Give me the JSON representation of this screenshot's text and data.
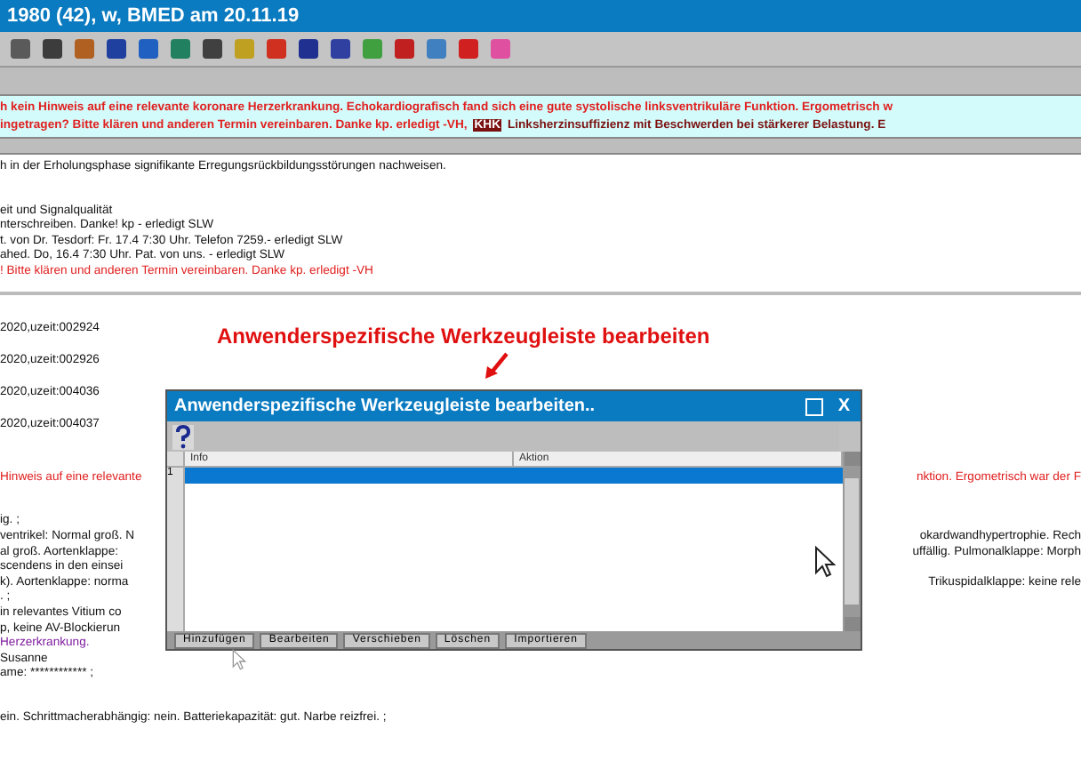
{
  "window": {
    "title": "1980 (42), w, BMED am 20.11.19"
  },
  "notice": {
    "lines": [
      {
        "parts": [
          {
            "text": "h kein Hinweis auf eine relevante koronare Herzerkrankung. Echokardiografisch fand sich eine gute systolische linksventrikuläre Funktion. Ergometrisch w",
            "kind": "alert"
          }
        ]
      },
      {
        "parts": [
          {
            "text": "ingetragen? Bitte klären und anderen Termin vereinbaren. Danke kp.  erledigt -VH,",
            "kind": "alert"
          },
          {
            "text": "KHK",
            "kind": "tag"
          },
          {
            "text": "Linksherzinsuffizienz mit Beschwerden bei stärkerer Belastung. E",
            "kind": "dark"
          }
        ]
      }
    ]
  },
  "blocks": [
    {
      "kind": "text",
      "lines": [
        {
          "left": "h in der Erholungsphase signifikante Erregungsrückbildungsstörungen nachweisen.",
          "kind": "plain"
        }
      ]
    },
    {
      "kind": "text",
      "lines": [
        {
          "left": "eit und Signalqualität",
          "kind": "plain"
        },
        {
          "left": "nterschreiben. Danke! kp - erledigt SLW",
          "kind": "plain"
        },
        {
          "left": "t. von Dr. Tesdorf: Fr. 17.4 7:30 Uhr. Telefon 7259.- erledigt SLW",
          "kind": "plain"
        },
        {
          "left": "ahed. Do, 16.4 7:30 Uhr. Pat. von uns. - erledigt SLW",
          "kind": "plain"
        },
        {
          "left": "! Bitte klären und anderen Termin vereinbaren. Danke kp.  erledigt -VH",
          "kind": "alert"
        }
      ]
    },
    {
      "kind": "divider"
    },
    {
      "kind": "records",
      "lines": [
        {
          "left": "2020,uzeit:002924",
          "kind": "plain"
        },
        {
          "left": "2020,uzeit:002926",
          "kind": "plain"
        },
        {
          "left": "2020,uzeit:004036",
          "kind": "plain"
        },
        {
          "left": "2020,uzeit:004037",
          "kind": "plain"
        }
      ]
    },
    {
      "kind": "text",
      "lines": [
        {
          "left": "Hinweis auf eine relevante",
          "right": "nktion. Ergometrisch war der F",
          "kind": "alert"
        }
      ]
    },
    {
      "kind": "text",
      "lines": [
        {
          "left": "ig. ;",
          "kind": "plain"
        },
        {
          "left": "ventrikel: Normal groß. N",
          "right": "okardwandhypertrophie. Rech",
          "kind": "plain"
        },
        {
          "left": "al groß. Aortenklappe:",
          "right": "uffällig. Pulmonalklappe: Morph",
          "kind": "plain"
        },
        {
          "left": "scendens in den einsei",
          "kind": "plain"
        },
        {
          "left": "k). Aortenklappe: norma",
          "right": "Trikuspidalklappe: keine rele",
          "kind": "plain"
        },
        {
          "left": ". ;",
          "kind": "plain"
        },
        {
          "left": "in relevantes Vitium co",
          "kind": "plain"
        },
        {
          "left": "p, keine AV-Blockierun",
          "kind": "plain"
        },
        {
          "left": "Herzerkrankung.",
          "kind": "link"
        },
        {
          "left": "Susanne",
          "kind": "plain"
        },
        {
          "left": "ame: ************ ;",
          "kind": "plain"
        }
      ]
    },
    {
      "kind": "text",
      "lines": [
        {
          "left": "ein. Schrittmacherabhängig: nein. Batteriekapazität: gut. Narbe reizfrei. ;",
          "kind": "plain"
        }
      ]
    }
  ],
  "annotation": {
    "label": "Anwenderspezifische Werkzeugleiste bearbeiten"
  },
  "dialog": {
    "title": "Anwenderspezifische Werkzeugleiste bearbeiten..",
    "close_label": "X",
    "columns": [
      "Info",
      "Aktion"
    ],
    "rows": [
      {
        "number": "1",
        "selected": true
      }
    ],
    "buttons": [
      "Hinzufügen",
      "Bearbeiten",
      "Verschieben",
      "Löschen",
      "Importieren"
    ]
  }
}
